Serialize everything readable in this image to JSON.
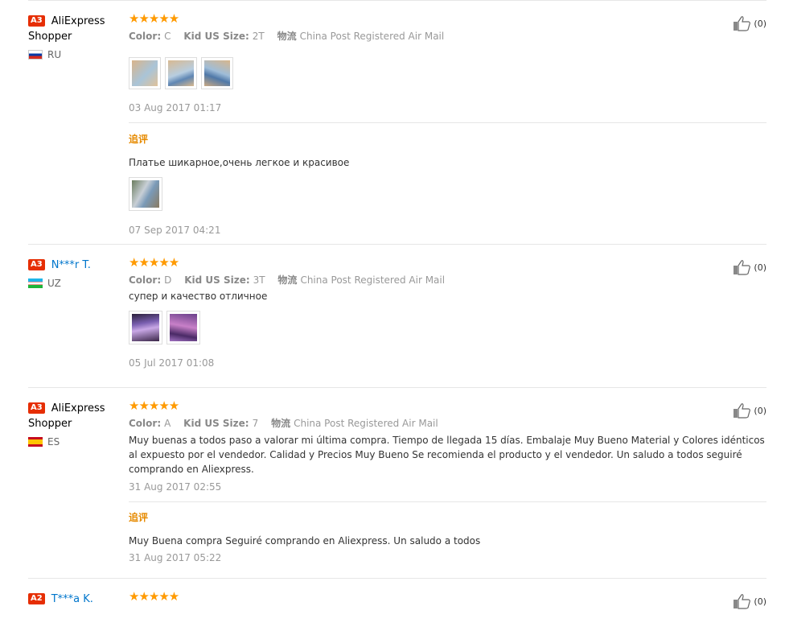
{
  "append_title": "追评",
  "labels": {
    "color": "Color:",
    "size": "Kid US Size:",
    "shipping": "物流"
  },
  "helpful_count": "(0)",
  "reviews": [
    {
      "level": "A3",
      "name": "AliExpress Shopper",
      "country": "RU",
      "rating": 5,
      "color": "C",
      "size": "2T",
      "shipping": "China Post Registered Air Mail",
      "text": "",
      "photo_count": 3,
      "date": "03 Aug 2017 01:17",
      "append": {
        "text": "Платье шикарное,очень легкое и красивое",
        "photo_count": 1,
        "date": "07 Sep 2017 04:21"
      }
    },
    {
      "level": "A3",
      "name": "N***r T.",
      "country": "UZ",
      "rating": 5,
      "color": "D",
      "size": "3T",
      "shipping": "China Post Registered Air Mail",
      "text": "супер и качество отличное",
      "photo_count": 2,
      "date": "05 Jul 2017 01:08"
    },
    {
      "level": "A3",
      "name": "AliExpress Shopper",
      "country": "ES",
      "rating": 5,
      "color": "A",
      "size": "7",
      "shipping": "China Post Registered Air Mail",
      "text": "Muy buenas a todos paso a valorar mi última compra. Tiempo de llegada 15 días. Embalaje Muy Bueno Material y Colores idénticos al expuesto por el vendedor. Calidad y Precios Muy Bueno Se recomienda el producto y el vendedor. Un saludo a todos seguiré comprando en Aliexpress.",
      "photo_count": 0,
      "date": "31 Aug 2017 02:55",
      "append": {
        "text": "Muy Buena compra Seguiré comprando en Aliexpress. Un saludo a todos",
        "photo_count": 0,
        "date": "31 Aug 2017 05:22"
      }
    },
    {
      "level": "A2",
      "name": "T***a K.",
      "country": "",
      "rating": 5
    }
  ]
}
